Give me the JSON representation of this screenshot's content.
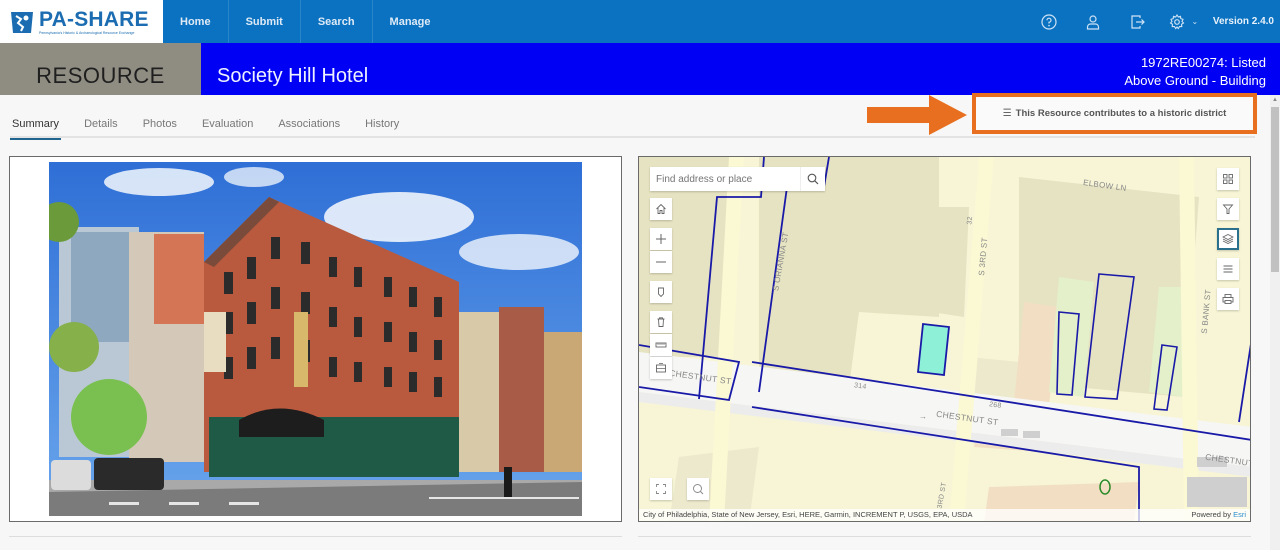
{
  "app": {
    "logo_title": "PA-SHARE",
    "logo_subtitle": "Pennsylvania's Historic & Archaeological Resource Exchange",
    "version": "Version 2.4.0"
  },
  "nav": {
    "items": [
      {
        "label": "Home"
      },
      {
        "label": "Submit"
      },
      {
        "label": "Search"
      },
      {
        "label": "Manage"
      }
    ],
    "icons": [
      "help-icon",
      "user-icon",
      "logout-icon",
      "settings-icon"
    ]
  },
  "resource": {
    "section_label": "RESOURCE",
    "title": "Society Hill Hotel",
    "id_status": "1972RE00274: Listed",
    "category": "Above Ground - Building"
  },
  "tabs": [
    {
      "label": "Summary",
      "active": true
    },
    {
      "label": "Details",
      "active": false
    },
    {
      "label": "Photos",
      "active": false
    },
    {
      "label": "Evaluation",
      "active": false
    },
    {
      "label": "Associations",
      "active": false
    },
    {
      "label": "History",
      "active": false
    }
  ],
  "district_notice": {
    "text": "This Resource contributes to a historic district",
    "highlight_color": "#e86f1f"
  },
  "photo": {
    "alt": "Society Hill Hotel - four-story red brick corner building with green storefront and black awning"
  },
  "map": {
    "search_placeholder": "Find address or place",
    "street_labels": {
      "elbow": "ELBOW LN",
      "third": "S 3RD ST",
      "orianna": "S ORIANNA ST",
      "bank": "S BANK ST",
      "chestnut_left": "CHESTNUT ST",
      "chestnut_mid": "CHESTNUT ST",
      "chestnut_right": "CHESTNUT",
      "third_bottom": "3RD ST",
      "num_314": "314",
      "num_268": "268",
      "num_32": "32"
    },
    "attribution": "City of Philadelphia, State of New Jersey, Esri, HERE, Garmin, INCREMENT P, USGS, EPA, USDA",
    "powered_by": "Powered by ",
    "powered_by_brand": "Esri"
  },
  "colors": {
    "nav_bg": "#0a72c0",
    "header_bg": "#0000f5",
    "label_bg": "#8f8c82",
    "highlight": "#e86f1f",
    "boundary": "#1a1aa8",
    "selected_parcel": "#8ff0d8"
  }
}
